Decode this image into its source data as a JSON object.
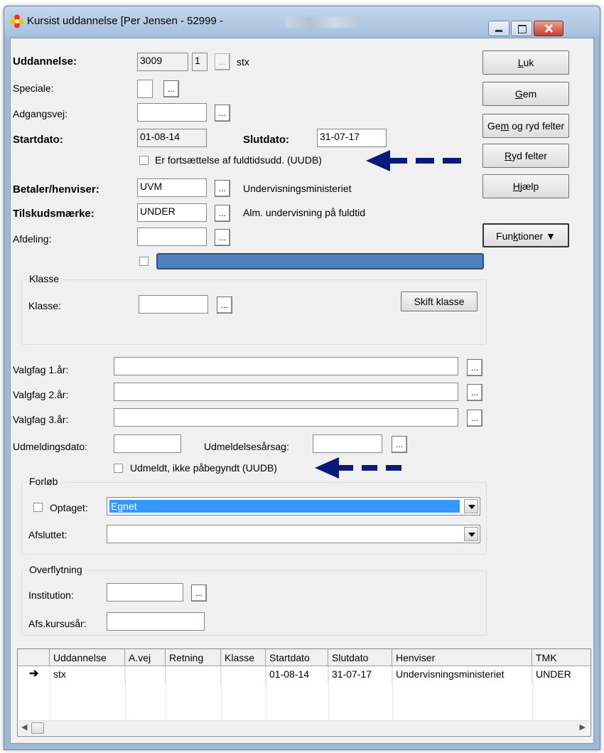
{
  "window": {
    "title": "Kursist uddannelse [Per Jensen - 52999 -"
  },
  "form": {
    "uddannelse_label": "Uddannelse:",
    "uddannelse_code": "3009",
    "uddannelse_num": "1",
    "uddannelse_name": "stx",
    "speciale_label": "Speciale:",
    "adgangsvej_label": "Adgangsvej:",
    "startdato_label": "Startdato:",
    "startdato_value": "01-08-14",
    "slutdato_label": "Slutdato:",
    "slutdato_value": "31-07-17",
    "fortsaettelse_label": "Er fortsættelse af fuldtidsudd. (UUDB)",
    "betaler_label": "Betaler/henviser:",
    "betaler_value": "UVM",
    "betaler_name": "Undervisningsministeriet",
    "tilskud_label": "Tilskudsmærke:",
    "tilskud_value": "UNDER",
    "tilskud_name": "Alm. undervisning på fuldtid",
    "afdeling_label": "Afdeling:",
    "dots": "...",
    "klasse_group": "Klasse",
    "klasse_label": "Klasse:",
    "skift_klasse": "Skift klasse",
    "valgfag1_label": "Valgfag 1.år:",
    "valgfag2_label": "Valgfag 2.år:",
    "valgfag3_label": "Valgfag 3.år:",
    "udmeldingsdato_label": "Udmeldingsdato:",
    "udmeldelsesaarsag_label": "Udmeldelsesårsag:",
    "udmeldt_label": "Udmeldt, ikke påbegyndt (UUDB)",
    "forloeb_group": "Forløb",
    "optaget_label": "Optaget:",
    "optaget_value": "Egnet",
    "afsluttet_label": "Afsluttet:",
    "overflytning_group": "Overflytning",
    "institution_label": "Institution:",
    "afskursusaar_label": "Afs.kursusår:"
  },
  "buttons": {
    "luk_pre": "",
    "luk_u": "L",
    "luk_post": "uk",
    "gem_pre": "",
    "gem_u": "G",
    "gem_post": "em",
    "gemryd_pre": "Ge",
    "gemryd_u": "m",
    "gemryd_post": " og ryd felter",
    "ryd_pre": "",
    "ryd_u": "R",
    "ryd_post": "yd felter",
    "hjaelp_pre": "",
    "hjaelp_u": "H",
    "hjaelp_post": "jælp",
    "funktioner_pre": "Fun",
    "funktioner_u": "k",
    "funktioner_post": "tioner"
  },
  "grid": {
    "headers": [
      "Uddannelse",
      "A.vej",
      "Retning",
      "Klasse",
      "Startdato",
      "Slutdato",
      "Henviser",
      "TMK"
    ],
    "row": [
      "stx",
      "",
      "",
      "",
      "01-08-14",
      "31-07-17",
      "Undervisningsministeriet",
      "UNDER"
    ]
  },
  "colors": {
    "arrow": "#0a1a7a",
    "selection": "#3399ff",
    "bar": "#4f81bd"
  }
}
